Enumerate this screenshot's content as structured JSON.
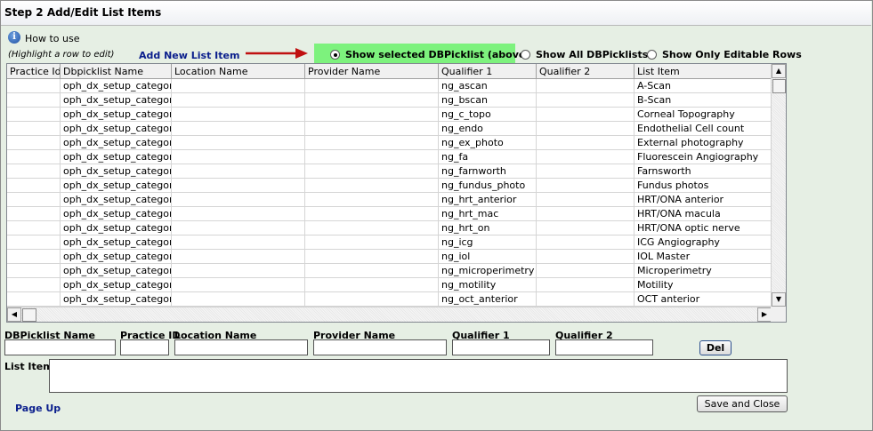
{
  "title": "Step 2 Add/Edit List Items",
  "howto": {
    "label": "How to use",
    "icon": "info-icon"
  },
  "hint": "(Highlight a row to edit)",
  "add_link": "Add New List Item",
  "radios": [
    {
      "label": "Show selected DBPicklist (above)",
      "selected": true
    },
    {
      "label": "Show All DBPicklists",
      "selected": false
    },
    {
      "label": "Show Only Editable Rows",
      "selected": false
    }
  ],
  "grid": {
    "columns": [
      "Practice Id",
      "Dbpicklist Name",
      "Location Name",
      "Provider Name",
      "Qualifier 1",
      "Qualifier 2",
      "List Item"
    ],
    "rows": [
      [
        "",
        "oph_dx_setup_category",
        "",
        "",
        "ng_ascan",
        "",
        "A-Scan"
      ],
      [
        "",
        "oph_dx_setup_category",
        "",
        "",
        "ng_bscan",
        "",
        "B-Scan"
      ],
      [
        "",
        "oph_dx_setup_category",
        "",
        "",
        "ng_c_topo",
        "",
        "Corneal Topography"
      ],
      [
        "",
        "oph_dx_setup_category",
        "",
        "",
        "ng_endo",
        "",
        "Endothelial Cell count"
      ],
      [
        "",
        "oph_dx_setup_category",
        "",
        "",
        "ng_ex_photo",
        "",
        "External photography"
      ],
      [
        "",
        "oph_dx_setup_category",
        "",
        "",
        "ng_fa",
        "",
        "Fluorescein Angiography"
      ],
      [
        "",
        "oph_dx_setup_category",
        "",
        "",
        "ng_farnworth",
        "",
        "Farnsworth"
      ],
      [
        "",
        "oph_dx_setup_category",
        "",
        "",
        "ng_fundus_photo",
        "",
        "Fundus photos"
      ],
      [
        "",
        "oph_dx_setup_category",
        "",
        "",
        "ng_hrt_anterior",
        "",
        "HRT/ONA anterior"
      ],
      [
        "",
        "oph_dx_setup_category",
        "",
        "",
        "ng_hrt_mac",
        "",
        "HRT/ONA macula"
      ],
      [
        "",
        "oph_dx_setup_category",
        "",
        "",
        "ng_hrt_on",
        "",
        "HRT/ONA optic nerve"
      ],
      [
        "",
        "oph_dx_setup_category",
        "",
        "",
        "ng_icg",
        "",
        "ICG Angiography"
      ],
      [
        "",
        "oph_dx_setup_category",
        "",
        "",
        "ng_iol",
        "",
        "IOL Master"
      ],
      [
        "",
        "oph_dx_setup_category",
        "",
        "",
        "ng_microperimetry",
        "",
        "Microperimetry"
      ],
      [
        "",
        "oph_dx_setup_category",
        "",
        "",
        "ng_motility",
        "",
        "Motility"
      ],
      [
        "",
        "oph_dx_setup_category",
        "",
        "",
        "ng_oct_anterior",
        "",
        "OCT anterior"
      ]
    ]
  },
  "form": {
    "labels": [
      "DBPicklist Name",
      "Practice ID",
      "Location Name",
      "Provider Name",
      "Qualifier 1",
      "Qualifier 2"
    ],
    "values": [
      "",
      "",
      "",
      "",
      "",
      ""
    ],
    "del_label": "Del",
    "list_item_label": "List Item",
    "list_item_value": ""
  },
  "page_up": "Page Up",
  "save_close": "Save and Close",
  "colors": {
    "highlight": "#7df27d",
    "link": "#0a1e8c",
    "arrow": "#c01010",
    "background": "#e6efe4"
  }
}
